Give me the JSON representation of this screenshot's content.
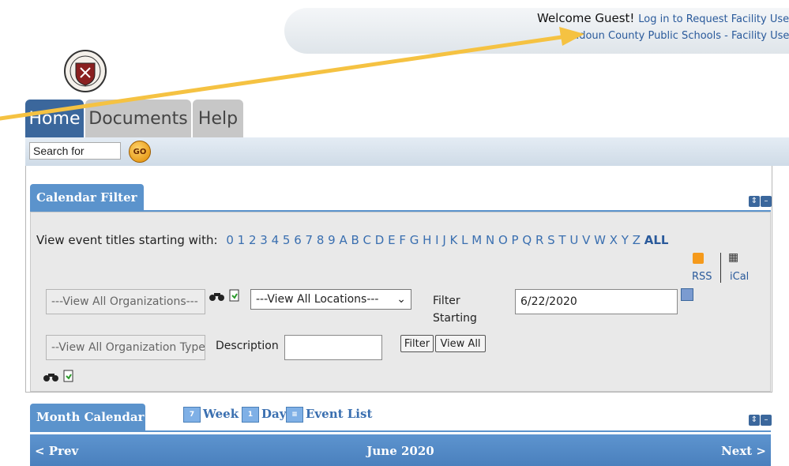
{
  "header": {
    "welcome_text": "Welcome Guest!",
    "login_link": "Log in to Request Facility Use",
    "site_subtitle": "Loudoun County Public Schools - Facility Use"
  },
  "nav": {
    "tabs": [
      {
        "label": "Home",
        "active": true
      },
      {
        "label": "Documents",
        "active": false
      },
      {
        "label": "Help",
        "active": false
      }
    ]
  },
  "search": {
    "value": "Search for",
    "go_label": "GO"
  },
  "calendar_filter": {
    "title": "Calendar Filter",
    "view_titles_label": "View event titles starting with:",
    "letters": "0 1 2 3 4 5 6 7 8 9 A B C D E F G H I J K L M N O P Q R S T U V W X Y Z",
    "all_label": "ALL",
    "rss_label": "RSS",
    "ical_label": "iCal",
    "organizations_value": "---View All Organizations---",
    "locations_value": "---View All Locations---",
    "filter_starting_label": "Filter Starting",
    "date_value": "6/22/2020",
    "org_type_value": "--View All Organization Types--",
    "description_label": "Description",
    "description_value": "",
    "filter_button": "Filter",
    "view_all_button": "View All"
  },
  "month_calendar": {
    "title": "Month Calendar",
    "views": [
      {
        "label": "Week",
        "icon_text": "7"
      },
      {
        "label": "Day",
        "icon_text": "1"
      },
      {
        "label": "Event List",
        "icon_text": "≡"
      }
    ],
    "prev_label": "< Prev",
    "month_label": "June 2020",
    "next_label": "Next >"
  },
  "colors": {
    "primary_blue": "#3b679c",
    "tab_blue": "#5b93cc",
    "annotation_arrow": "#f5c242"
  }
}
